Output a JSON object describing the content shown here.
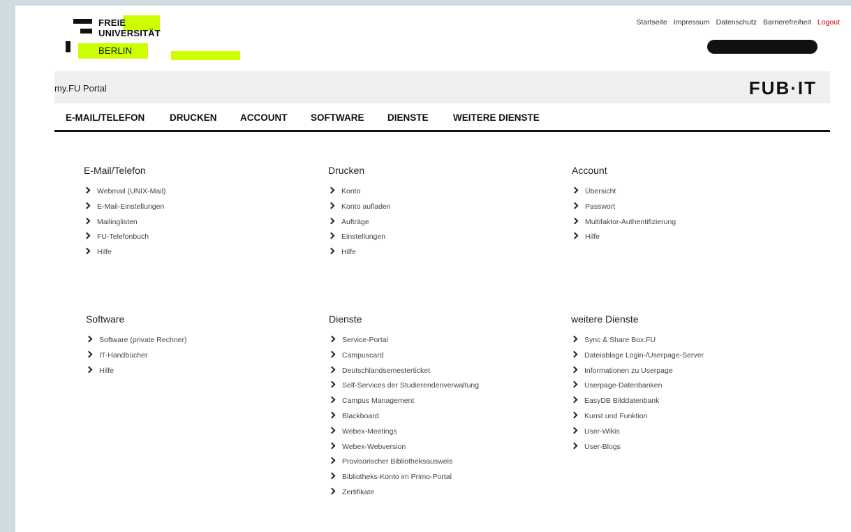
{
  "logo": {
    "line1": "FREIE",
    "line2": "UNIVERSITÄT",
    "line3": "BERLIN"
  },
  "topnav": [
    "Startseite",
    "Impressum",
    "Datenschutz",
    "Barrierefreiheit",
    "Logout"
  ],
  "portal_title": "my.FU Portal",
  "brand_logo": "FUB·IT",
  "mainnav": [
    "E-MAIL/TELEFON",
    "DRUCKEN",
    "ACCOUNT",
    "SOFTWARE",
    "DIENSTE",
    "WEITERE DIENSTE"
  ],
  "sections": [
    {
      "title": "E-Mail/Telefon",
      "items": [
        "Webmail (UNIX-Mail)",
        "E-Mail-Einstellungen",
        "Mailinglisten",
        "FU-Telefonbuch",
        "Hilfe"
      ]
    },
    {
      "title": "Drucken",
      "items": [
        "Konto",
        "Konto aufladen",
        "Aufträge",
        "Einstellungen",
        "Hilfe"
      ]
    },
    {
      "title": "Account",
      "items": [
        "Übersicht",
        "Passwort",
        "Multifaktor-Authentifizierung",
        "Hilfe"
      ]
    },
    {
      "title": "Software",
      "items": [
        "Software (private Rechner)",
        "IT-Handbücher",
        "Hilfe"
      ]
    },
    {
      "title": "Dienste",
      "items": [
        "Service-Portal",
        "Campuscard",
        "Deutschlandsemesterticket",
        "Self-Services der Studierendenverwaltung",
        "Campus Management",
        "Blackboard",
        "Webex-Meetings",
        "Webex-Webversion",
        "Provisorischer Bibliotheksausweis",
        "Bibliotheks-Konto im Primo-Portal",
        "Zertifikate"
      ]
    },
    {
      "title": "weitere Dienste",
      "items": [
        "Sync & Share Box.FU",
        "Dateiablage Login-/Userpage-Server",
        "Informationen zu Userpage",
        "Userpage-Datenbanken",
        "EasyDB Bilddatenbank",
        "Kunst und Funktion",
        "User-Wikis",
        "User-Blogs"
      ]
    }
  ]
}
